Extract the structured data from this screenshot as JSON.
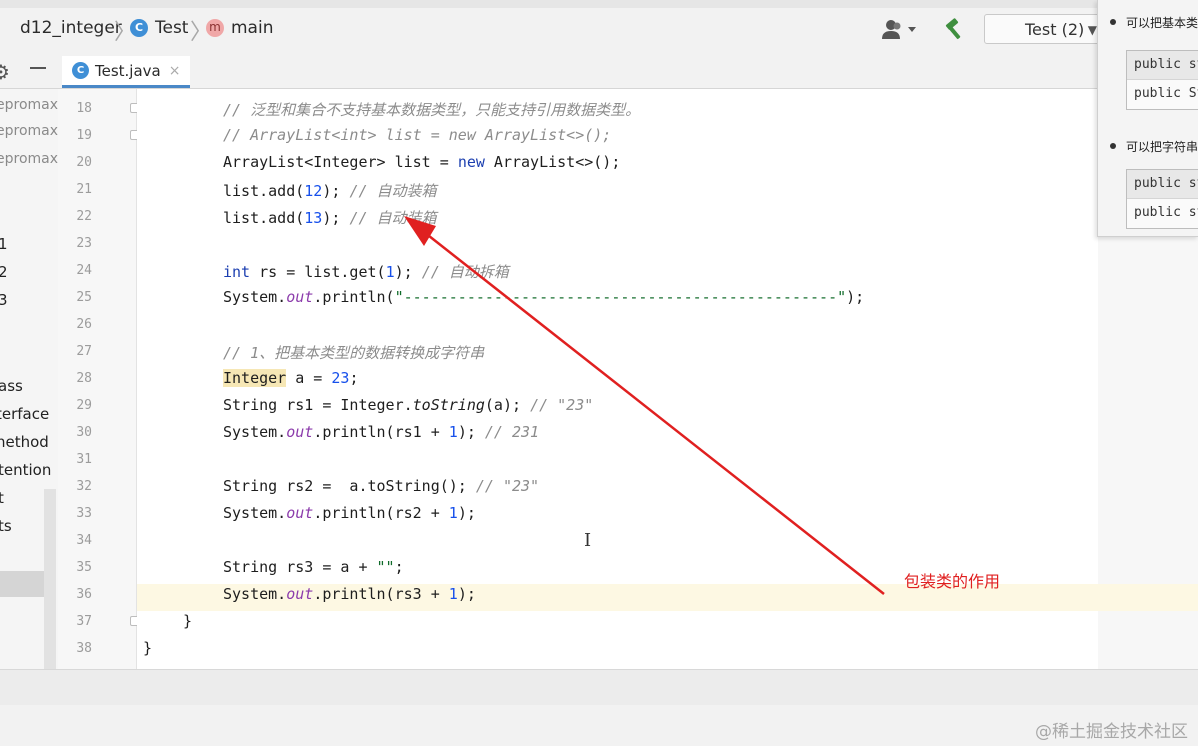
{
  "breadcrumbs": {
    "module": "d12_integer",
    "class": "Test",
    "method": "main",
    "class_badge": "C",
    "method_badge": "m"
  },
  "toolbar": {
    "run_config": "Test (2)",
    "user_icon": "user-icon",
    "build_icon": "hammer-icon"
  },
  "tab": {
    "label": "Test.java",
    "badge": "C",
    "close": "×"
  },
  "left_panel": {
    "items": [
      "epromax",
      "epromax",
      "epromax",
      "1",
      "2",
      "3",
      "ass",
      "terface",
      "nethod",
      "tention",
      "t",
      "ts"
    ]
  },
  "gutter": {
    "line_numbers": [
      "18",
      "19",
      "20",
      "21",
      "22",
      "23",
      "24",
      "25",
      "26",
      "27",
      "28",
      "29",
      "30",
      "31",
      "32",
      "33",
      "34",
      "35",
      "36",
      "37",
      "38"
    ]
  },
  "code": {
    "l18_comment": "// 泛型和集合不支持基本数据类型，只能支持引用数据类型。",
    "l19_comment": "// ArrayList<int> list = new ArrayList<>();",
    "l20_a": "ArrayList<Integer> list = ",
    "l20_kw": "new",
    "l20_b": " ArrayList<>();",
    "l21_a": "list.add(",
    "l21_num": "12",
    "l21_b": "); ",
    "l21_cmt": "// 自动装箱",
    "l22_a": "list.add(",
    "l22_num": "13",
    "l22_b": "); ",
    "l22_cmt": "// 自动装箱",
    "l24_kw": "int",
    "l24_a": " rs = list.get(",
    "l24_num": "1",
    "l24_b": "); ",
    "l24_cmt": "// 自动拆箱",
    "l25_a": "System.",
    "l25_fld": "out",
    "l25_b": ".println(",
    "l25_str": "\"------------------------------------------------\"",
    "l25_c": ");",
    "l27_comment": "// 1、把基本类型的数据转换成字符串",
    "l28_hl": "Integer",
    "l28_a": " a = ",
    "l28_num": "23",
    "l28_b": ";",
    "l29_a": "String rs1 = Integer.",
    "l29_mth": "toString",
    "l29_b": "(a); ",
    "l29_cmt": "// \"23\"",
    "l30_a": "System.",
    "l30_fld": "out",
    "l30_b": ".println(rs1 + ",
    "l30_num": "1",
    "l30_c": "); ",
    "l30_cmt": "// 231",
    "l32_a": "String rs2 =  a.toString(); ",
    "l32_cmt": "// \"23\"",
    "l33_a": "System.",
    "l33_fld": "out",
    "l33_b": ".println(rs2 + ",
    "l33_num": "1",
    "l33_c": ");",
    "l35_a": "String rs3 = a + ",
    "l35_str": "\"\"",
    "l35_b": ";",
    "l36_a": "System.",
    "l36_fld": "out",
    "l36_b": ".println(rs3 + ",
    "l36_num": "1",
    "l36_c": ");",
    "l37": "}",
    "l38": "}"
  },
  "popup": {
    "bullet1": "可以把基本类",
    "box1_row1": "public stat",
    "box1_row2": "public Strin",
    "bullet2": "可以把字符串",
    "box2_row1": "public stat",
    "box2_row2": "public stat"
  },
  "annotation": {
    "label": "包装类的作用",
    "color": "#e02020"
  },
  "watermark": "@稀土掘金技术社区"
}
